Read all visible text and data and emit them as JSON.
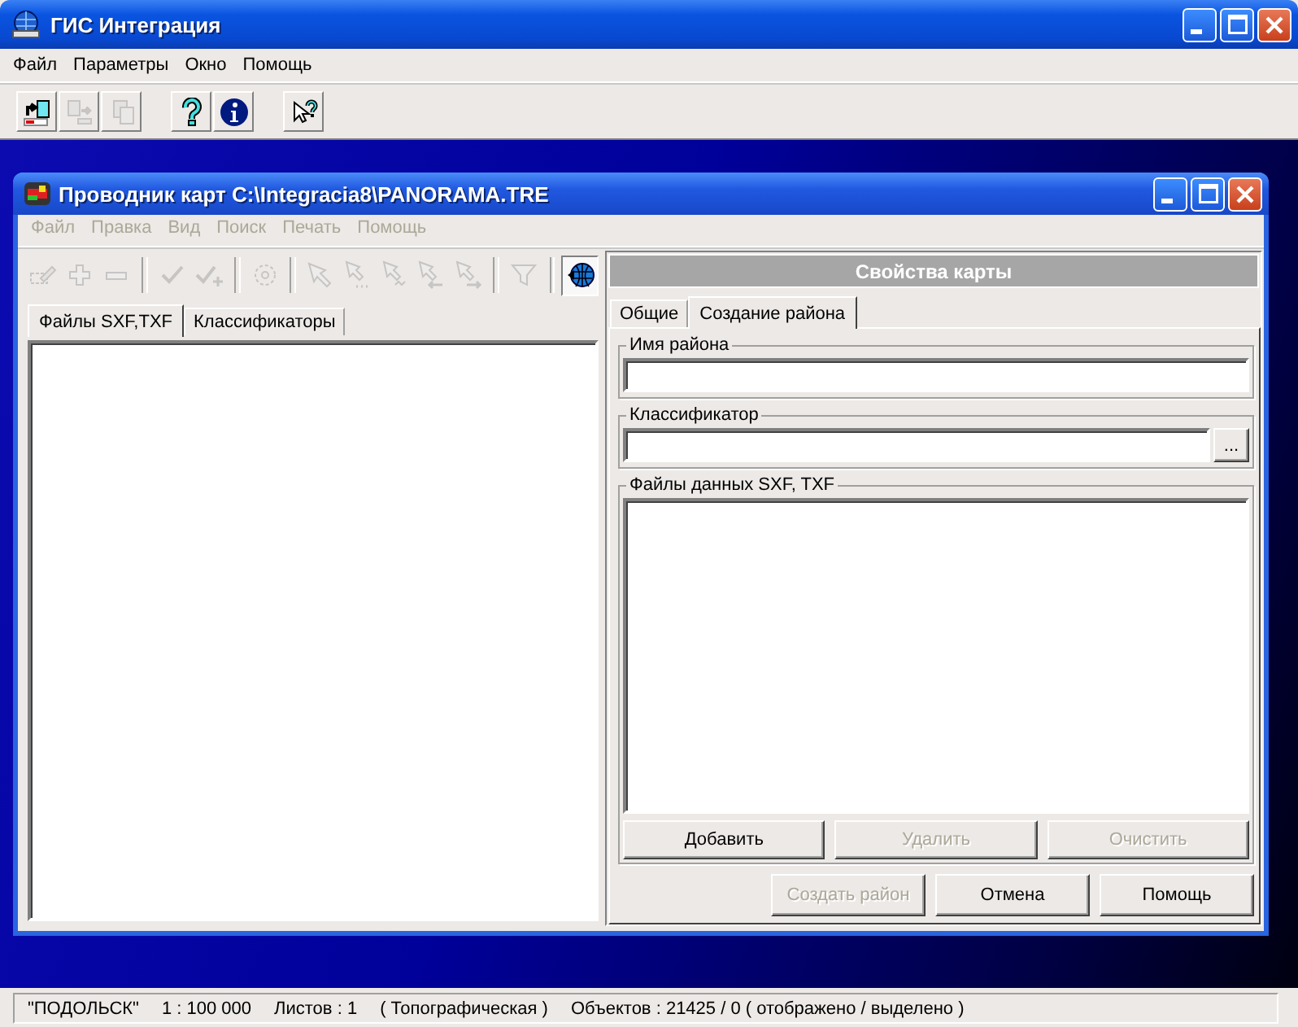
{
  "window": {
    "title": "ГИС Интеграция"
  },
  "menu": [
    "Файл",
    "Параметры",
    "Окно",
    "Помощь"
  ],
  "toolbar": [
    {
      "kind": "open",
      "disabled": false
    },
    {
      "kind": "copy",
      "disabled": true
    },
    {
      "kind": "paste",
      "disabled": true
    },
    {
      "kind": "separator"
    },
    {
      "kind": "help",
      "disabled": false
    },
    {
      "kind": "info",
      "disabled": false
    },
    {
      "kind": "separator"
    },
    {
      "kind": "context-help",
      "disabled": false
    }
  ],
  "child": {
    "title": "Проводник карт C:\\Integracia8\\PANORAMA.TRE",
    "menu": [
      {
        "label": "Файл",
        "disabled": true
      },
      {
        "label": "Правка",
        "disabled": true
      },
      {
        "label": "Вид",
        "disabled": true
      },
      {
        "label": "Поиск",
        "disabled": true
      },
      {
        "label": "Печать",
        "disabled": true
      },
      {
        "label": "Помощь",
        "disabled": true
      }
    ],
    "toolbar": [
      {
        "kind": "edit",
        "disabled": true
      },
      {
        "kind": "add",
        "disabled": true
      },
      {
        "kind": "remove",
        "disabled": true
      },
      {
        "kind": "separator"
      },
      {
        "kind": "check",
        "disabled": true
      },
      {
        "kind": "check-plus",
        "disabled": true
      },
      {
        "kind": "separator"
      },
      {
        "kind": "circle",
        "disabled": true
      },
      {
        "kind": "separator"
      },
      {
        "kind": "select",
        "disabled": true
      },
      {
        "kind": "select-more",
        "disabled": true
      },
      {
        "kind": "select-wave",
        "disabled": true
      },
      {
        "kind": "select-left",
        "disabled": true
      },
      {
        "kind": "select-right",
        "disabled": true
      },
      {
        "kind": "separator"
      },
      {
        "kind": "filter",
        "disabled": true
      },
      {
        "kind": "separator"
      },
      {
        "kind": "globe",
        "disabled": false,
        "pressed": true
      }
    ],
    "left_tabs": [
      {
        "label": "Файлы SXF,TXF",
        "selected": true
      },
      {
        "label": "Классификаторы",
        "selected": false
      }
    ],
    "properties": {
      "header": "Свойства карты",
      "tabs": [
        {
          "label": "Общие",
          "selected": false
        },
        {
          "label": "Создание района",
          "selected": true
        }
      ],
      "name_group": {
        "label": "Имя района"
      },
      "classifier_group": {
        "label": "Классификатор",
        "browse_button": "..."
      },
      "files_group": {
        "label": "Файлы данных SXF, TXF",
        "buttons": [
          {
            "label": "Добавить",
            "disabled": false
          },
          {
            "label": "Удалить",
            "disabled": true
          },
          {
            "label": "Очистить",
            "disabled": true
          }
        ]
      },
      "buttons": [
        {
          "label": "Создать район",
          "disabled": true
        },
        {
          "label": "Отмена",
          "disabled": false
        },
        {
          "label": "Помощь",
          "disabled": false
        }
      ]
    }
  },
  "status_bar": [
    "\"ПОДОЛЬСК\"",
    "1 : 100 000",
    "Листов : 1",
    "( Топографическая )",
    "Объектов : 21425 / 0 ( отображено / выделено )"
  ]
}
